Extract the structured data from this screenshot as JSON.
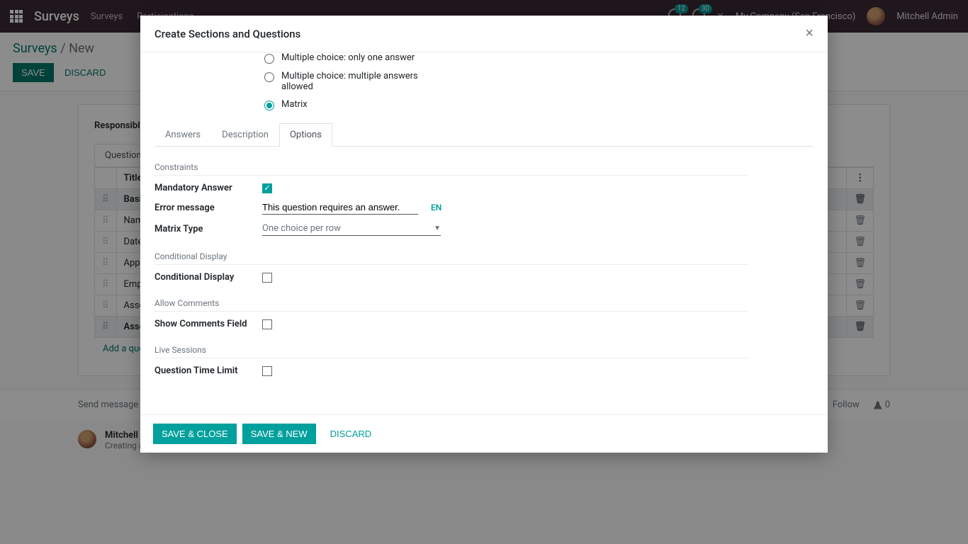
{
  "topnav": {
    "brand": "Surveys",
    "menu": [
      "Surveys",
      "Participations"
    ],
    "badges": {
      "chats": "12",
      "activities": "30"
    },
    "company": "My Company (San Francisco)",
    "username": "Mitchell Admin"
  },
  "control": {
    "breadcrumb_root": "Surveys",
    "breadcrumb_current": "New",
    "save_label": "SAVE",
    "discard_label": "DISCARD"
  },
  "bgform": {
    "responsible_label": "Responsible",
    "tab_questions": "Questions",
    "th_title": "Title",
    "rows": [
      {
        "title": "Basic Information",
        "section": true
      },
      {
        "title": "Name",
        "section": false
      },
      {
        "title": "Date of Birth",
        "section": false
      },
      {
        "title": "Apprisal Period",
        "section": false
      },
      {
        "title": "Employee Id",
        "section": false
      },
      {
        "title": "Assesment Details",
        "section": false
      },
      {
        "title": "Assesment Details",
        "section": true
      }
    ],
    "add_question": "Add a question"
  },
  "chatter": {
    "send": "Send message",
    "follow_count": "0",
    "log_user_prefix": "Mitchell"
  },
  "modal": {
    "title": "Create Sections and Questions",
    "radios": [
      {
        "label": "Multiple choice: only one answer",
        "checked": false
      },
      {
        "label": "Multiple choice: multiple answers allowed",
        "checked": false
      },
      {
        "label": "Matrix",
        "checked": true
      }
    ],
    "tabs": {
      "answers": "Answers",
      "description": "Description",
      "options": "Options"
    },
    "sections": {
      "constraints": "Constraints",
      "conditional": "Conditional Display",
      "comments": "Allow Comments",
      "live": "Live Sessions"
    },
    "fields": {
      "mandatory_label": "Mandatory Answer",
      "mandatory_checked": true,
      "error_label": "Error message",
      "error_value": "This question requires an answer.",
      "lang": "EN",
      "matrix_label": "Matrix Type",
      "matrix_value": "One choice per row",
      "cond_label": "Conditional Display",
      "cond_checked": false,
      "comments_label": "Show Comments Field",
      "comments_checked": false,
      "time_label": "Question Time Limit",
      "time_checked": false
    },
    "footer": {
      "save_close": "SAVE & CLOSE",
      "save_new": "SAVE & NEW",
      "discard": "DISCARD"
    }
  }
}
